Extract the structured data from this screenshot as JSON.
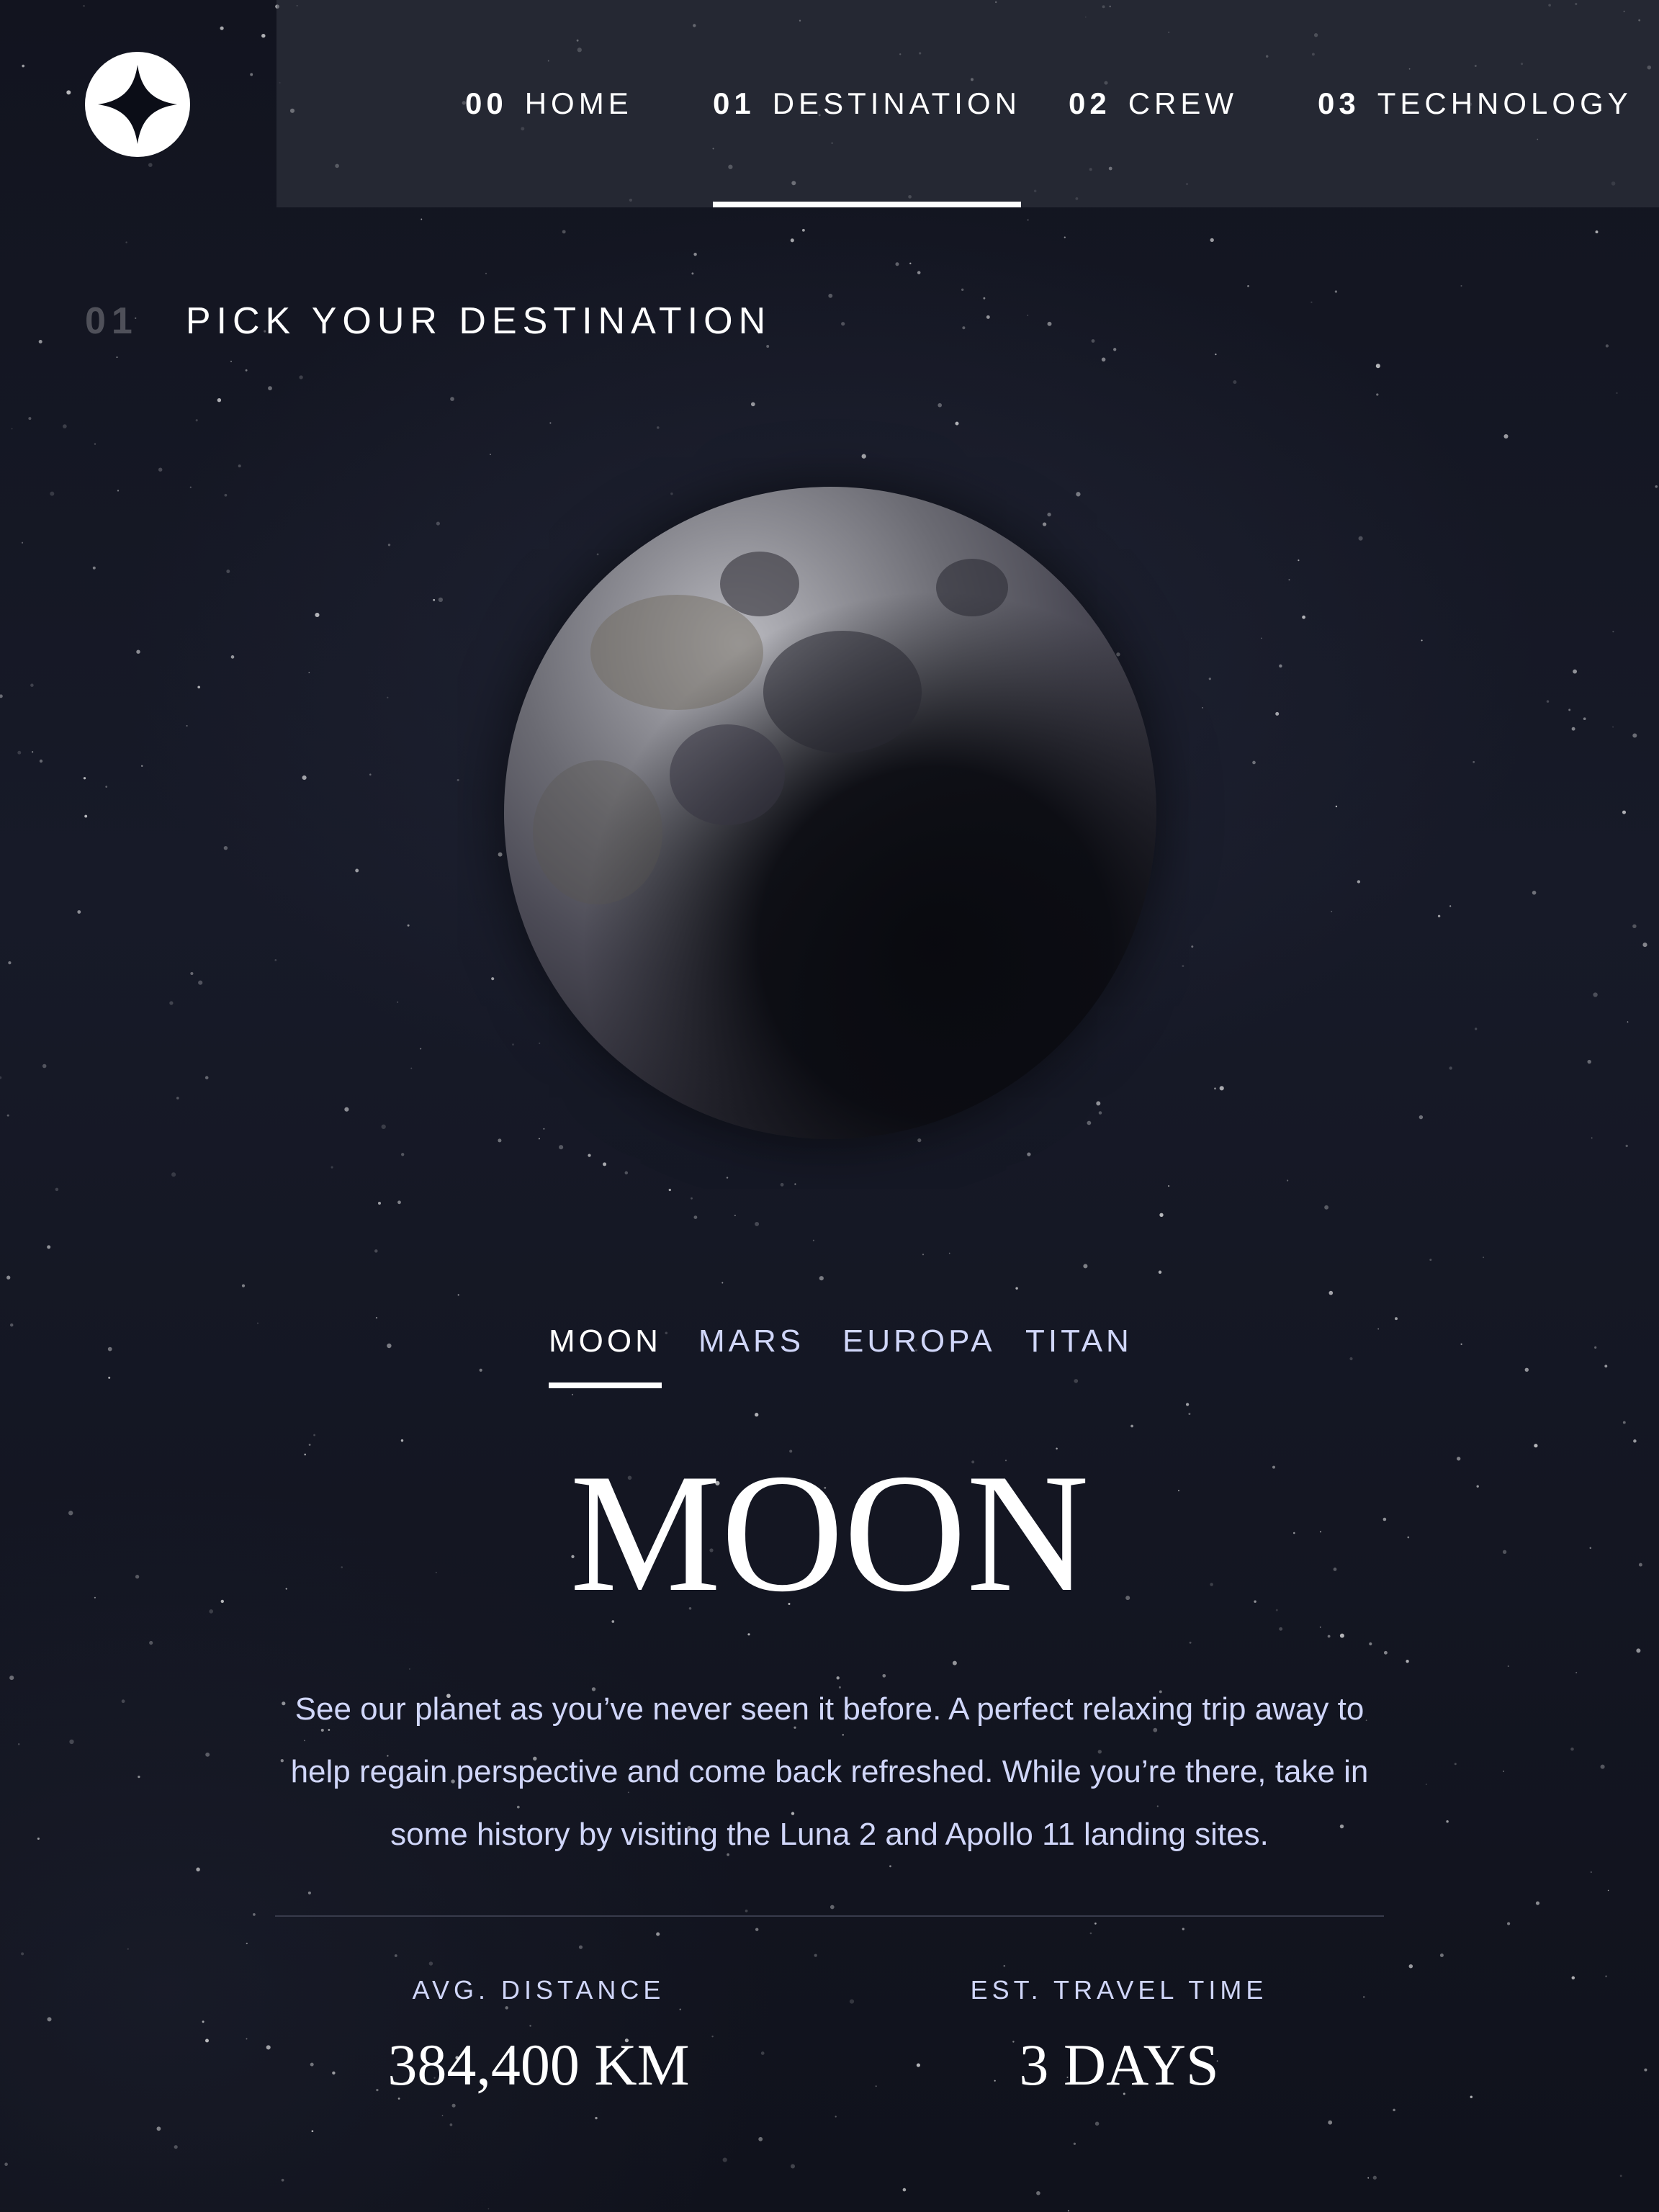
{
  "nav": {
    "items": [
      {
        "num": "00",
        "label": "HOME"
      },
      {
        "num": "01",
        "label": "DESTINATION"
      },
      {
        "num": "02",
        "label": "CREW"
      },
      {
        "num": "03",
        "label": "TECHNOLOGY"
      }
    ],
    "active_index": 1
  },
  "eyebrow": {
    "num": "01",
    "label": "PICK YOUR DESTINATION"
  },
  "tabs": [
    "MOON",
    "MARS",
    "EUROPA",
    "TITAN"
  ],
  "active_tab": "MOON",
  "destination": {
    "name": "MOON",
    "description": "See our planet as you’ve never seen it before. A perfect relaxing trip away to help regain perspective and come back refreshed. While you’re there, take in some history by visiting the Luna 2 and Apollo 11 landing sites.",
    "distance_label": "AVG. DISTANCE",
    "distance_value": "384,400 KM",
    "travel_label": "EST. TRAVEL TIME",
    "travel_value": "3 DAYS"
  },
  "colors": {
    "background": "#0b0d17",
    "accent": "#d0d6f9",
    "white": "#ffffff"
  }
}
